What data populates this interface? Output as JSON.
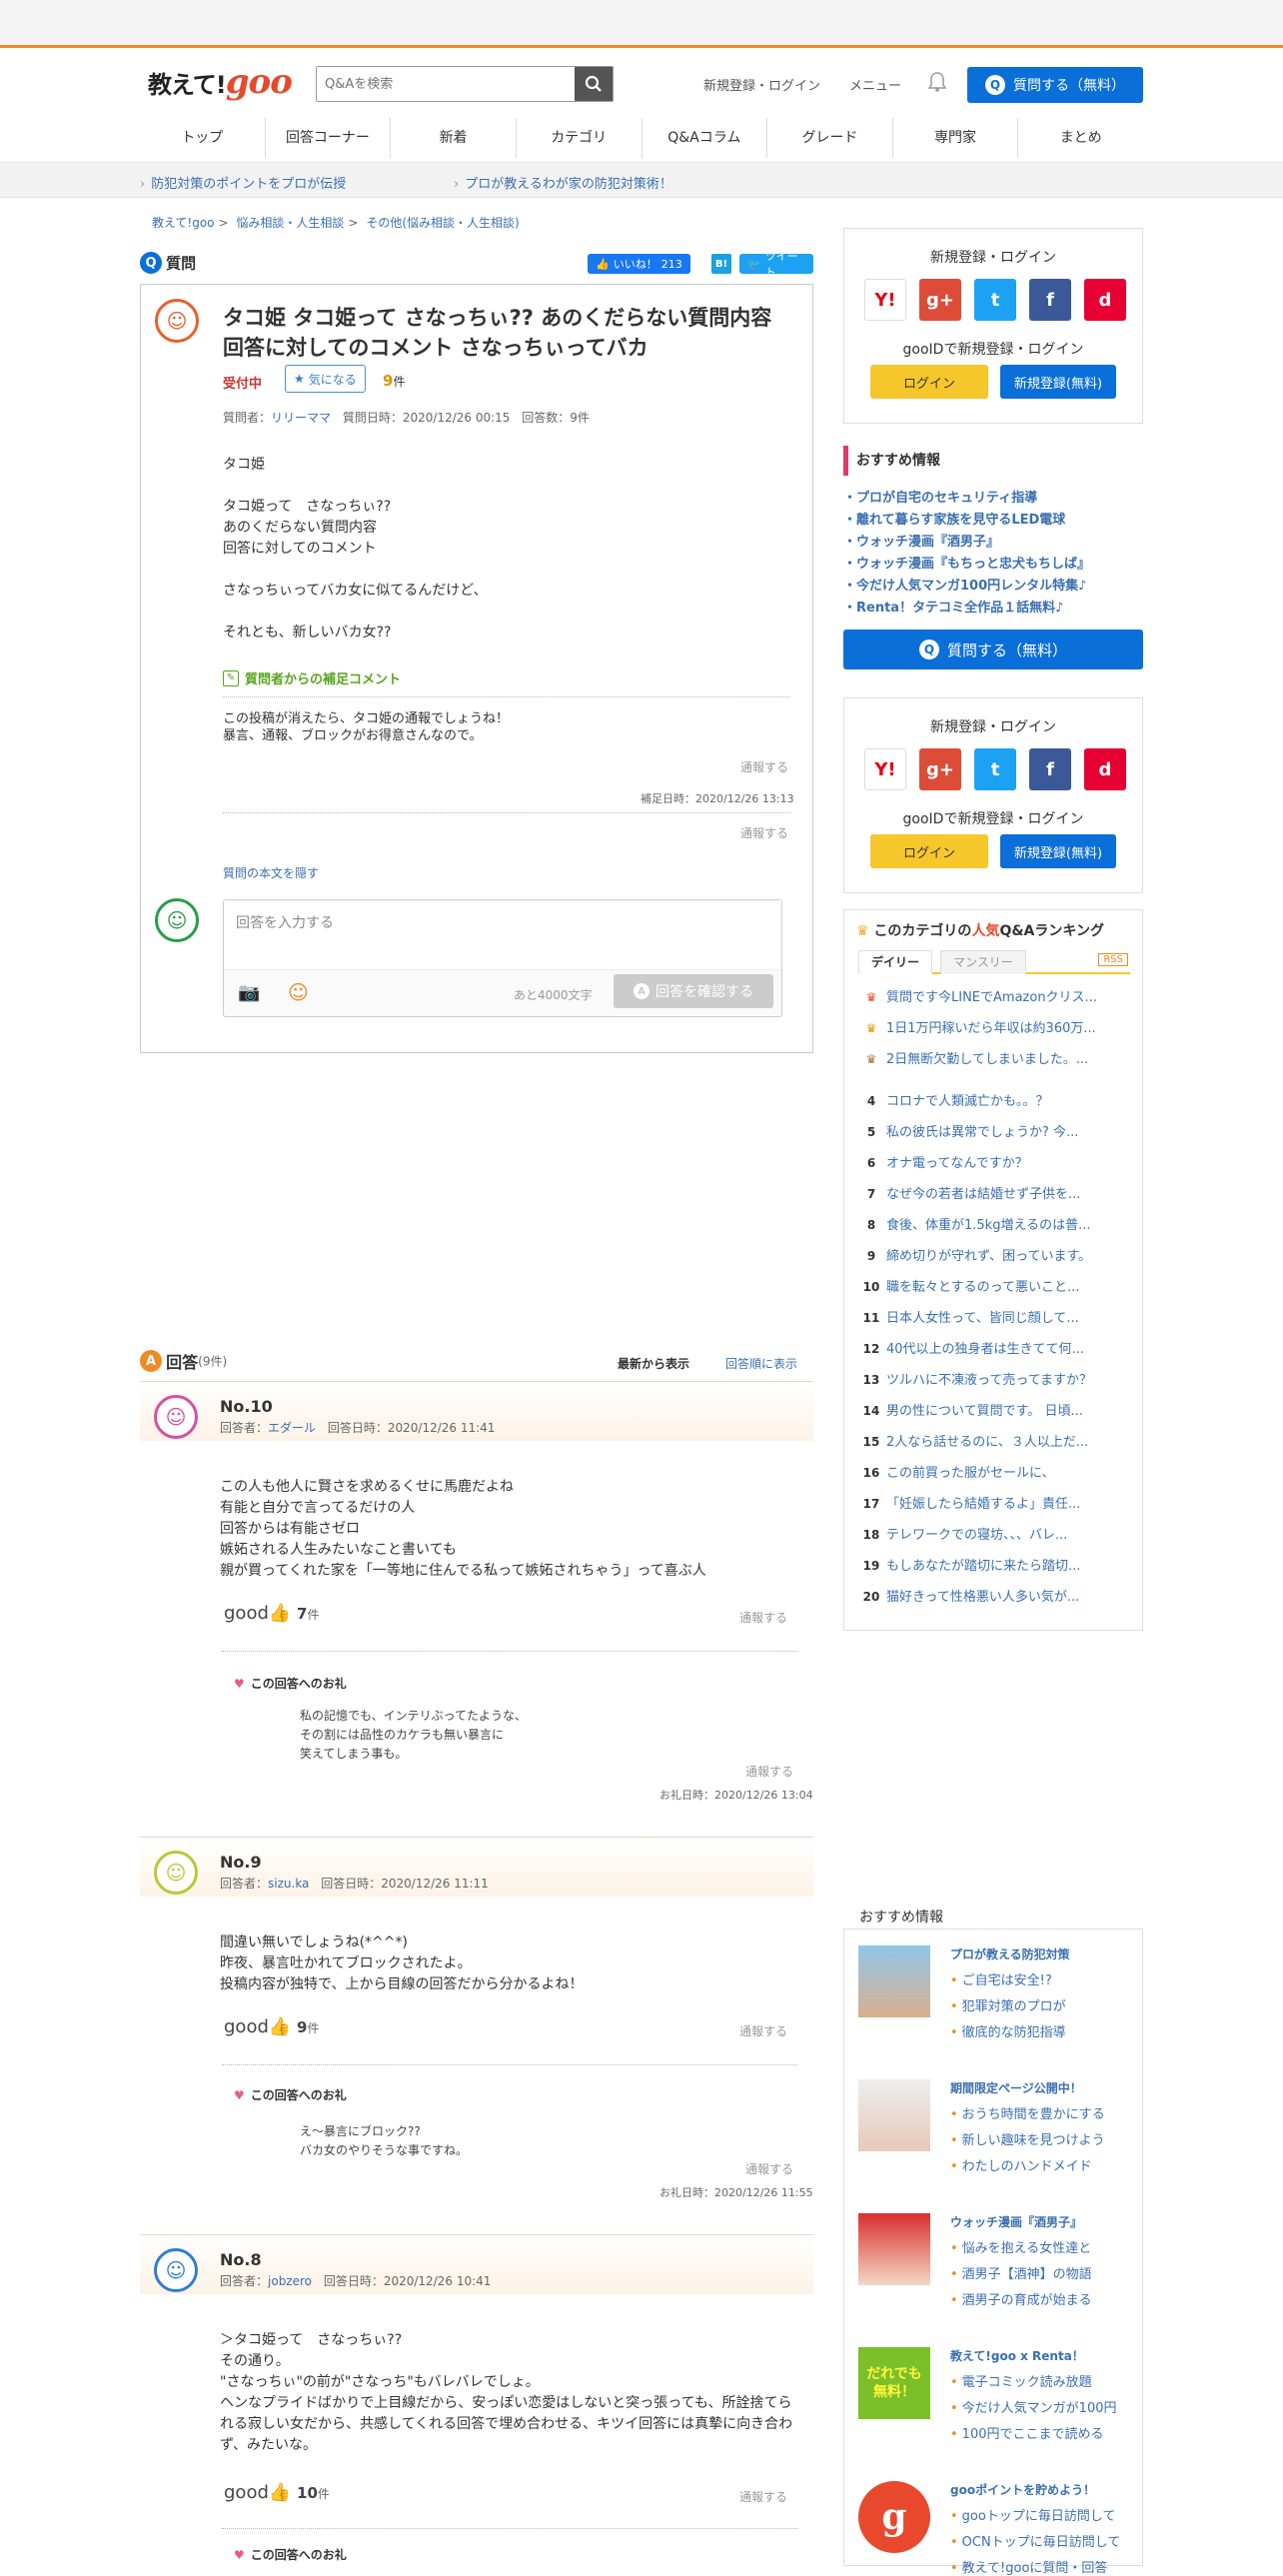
{
  "header": {
    "logo_text": "教えて!",
    "logo_brand": "goo",
    "search_placeholder": "Q&Aを検索",
    "register_login": "新規登録・ログイン",
    "menu": "メニュー",
    "ask_button": "質問する（無料）"
  },
  "nav": [
    "トップ",
    "回答コーナー",
    "新着",
    "カテゴリ",
    "Q&Aコラム",
    "グレード",
    "専門家",
    "まとめ"
  ],
  "subbar": [
    "防犯対策のポイントをプロが伝授",
    "プロが教えるわが家の防犯対策術！"
  ],
  "breadcrumb": [
    "教えて!goo",
    "悩み相談・人生相談",
    "その他(悩み相談・人生相談)"
  ],
  "question": {
    "section_label": "質問",
    "like_label": "いいね！",
    "like_count": "213",
    "hatena": "B!",
    "tweet": "ツイート",
    "title": "タコ姫 タコ姫って さなっちぃ?? あのくだらない質問内容 回答に対してのコメント さなっちぃってバカ",
    "status": "受付中",
    "favorite": "気になる",
    "answer_count": "9",
    "answer_count_unit": "件",
    "asker_label": "質問者：",
    "asker": "リリーママ",
    "date_label": "質問日時：2020/12/26 00:15",
    "answers_label": "回答数：9件",
    "body": "タコ姫\n\nタコ姫って　さなっちぃ??\nあのくだらない質問内容\n回答に対してのコメント\n\nさなっちぃってバカ女に似てるんだけど、\n\nそれとも、新しいバカ女??",
    "supplement_head": "質問者からの補足コメント",
    "supplement_body": "この投稿が消えたら、タコ姫の通報でしょうね！\n暴言、通報、ブロックがお得意さんなので。",
    "report": "通報する",
    "supplement_date": "補足日時：2020/12/26 13:13",
    "hide_body": "質問の本文を隠す",
    "answer_placeholder": "回答を入力する",
    "remaining": "あと4000文字",
    "confirm": "回答を確認する"
  },
  "answers_header": {
    "label": "回答",
    "count": "(9件)",
    "sort_new": "最新から表示",
    "sort_order": "回答順に表示"
  },
  "answers": [
    {
      "no": "No.10",
      "answerer_label": "回答者：",
      "answerer": "エダール",
      "date": "回答日時：2020/12/26 11:41",
      "body": "この人も他人に賢さを求めるくせに馬鹿だよね\n有能と自分で言ってるだけの人\n回答からは有能さゼロ\n嫉妬される人生みたいなこと書いても\n親が買ってくれた家を「一等地に住んでる私って嫉妬されちゃう」って喜ぶ人",
      "good_label": "good",
      "good_count": "7",
      "good_unit": "件",
      "report": "通報する",
      "thanks_head": "この回答へのお礼",
      "thanks_body": "私の記憶でも、インテリぶってたような、\nその割には品性のカケラも無い暴言に\n笑えてしまう事も。",
      "thanks_date": "お礼日時：2020/12/26 13:04"
    },
    {
      "no": "No.9",
      "answerer_label": "回答者：",
      "answerer": "sizu.ka",
      "date": "回答日時：2020/12/26 11:11",
      "body": "間違い無いでしょうね(*^^*)\n昨夜、暴言吐かれてブロックされたよ。\n投稿内容が独特で、上から目線の回答だから分かるよね！",
      "good_label": "good",
      "good_count": "9",
      "good_unit": "件",
      "report": "通報する",
      "thanks_head": "この回答へのお礼",
      "thanks_body": "え～暴言にブロック??\nバカ女のやりそうな事ですね。",
      "thanks_date": "お礼日時：2020/12/26 11:55"
    },
    {
      "no": "No.8",
      "answerer_label": "回答者：",
      "answerer": "jobzero",
      "date": "回答日時：2020/12/26 10:41",
      "body": "＞タコ姫って　さなっちぃ??\nその通り。\n\"さなっちぃ\"の前が\"さなっち\"もバレバレでしょ。\nヘンなプライドばかりで上目線だから、安っぽい恋愛はしないと突っ張っても、所詮捨てられる寂しい女だから、共感してくれる回答で埋め合わせる、キツイ回答には真摯に向き合わず、みたいな。",
      "good_label": "good",
      "good_count": "10",
      "good_unit": "件",
      "report": "通報する",
      "thanks_head": "この回答へのお礼"
    }
  ],
  "sidebar": {
    "login_title": "新規登録・ログイン",
    "gooid_text": "gooIDで新規登録・ログイン",
    "login": "ログイン",
    "register": "新規登録(無料)",
    "sns": [
      "Y!",
      "g+",
      "t",
      "f",
      "d"
    ],
    "recommend_title": "おすすめ情報",
    "recommend": [
      "・プロが自宅のセキュリティ指導",
      "・離れて暮らす家族を見守るLED電球",
      "・ウォッチ漫画『酒男子』",
      "・ウォッチ漫画『もちっと忠犬もちしば』",
      "・今だけ人気マンガ100円レンタル特集♪",
      "・Renta！タテコミ全作品１話無料♪"
    ],
    "ask_button": "質問する（無料）",
    "ranking_title_pre": "このカテゴリの",
    "ranking_title_em": "人気",
    "ranking_title_post": "Q&Aランキング",
    "tab_daily": "デイリー",
    "tab_monthly": "マンスリー",
    "rss": "RSS",
    "ranking": [
      "質問です今LINEでAmazonクリス...",
      "1日1万円稼いだら年収は約360万...",
      "2日無断欠勤してしまいました。...",
      "コロナで人類滅亡かも。。？",
      "私の彼氏は異常でしょうか? 今...",
      "オナ電ってなんですか？",
      "なぜ今の若者は結婚せず子供を...",
      "食後、体重が1.5kg増えるのは普...",
      "締め切りが守れず、困っています。",
      "職を転々とするのって悪いこと...",
      "日本人女性って、皆同じ顔して...",
      "40代以上の独身者は生きてて何...",
      "ツルハに不凍液って売ってますか？",
      "男の性について質問です。 日頃...",
      "2人なら話せるのに、３人以上だ...",
      "この前買った服がセールに、",
      "「妊娠したら結婚するよ」責任...",
      "テレワークでの寝坊、、、バレ...",
      "もしあなたが踏切に来たら踏切...",
      "猫好きって性格悪い人多い気が..."
    ],
    "rec2_title": "おすすめ情報",
    "rec2": [
      {
        "title": "プロが教える防犯対策",
        "items": [
          "ご自宅は安全!?",
          "犯罪対策のプロが",
          "徹底的な防犯指導"
        ]
      },
      {
        "title": "期間限定ページ公開中！",
        "items": [
          "おうち時間を豊かにする",
          "新しい趣味を見つけよう",
          "わたしのハンドメイド"
        ]
      },
      {
        "title": "ウォッチ漫画『酒男子』",
        "items": [
          "悩みを抱える女性達と",
          "酒男子【酒神】の物語",
          "酒男子の育成が始まる"
        ]
      },
      {
        "title": "教えて!goo x Renta！",
        "items": [
          "電子コミック読み放題",
          "今だけ人気マンガが100円",
          "100円でここまで読める"
        ],
        "badge": "だれでも\n無料！"
      },
      {
        "title": "gooポイントを貯めよう！",
        "items": [
          "gooトップに毎日訪問して",
          "OCNトップに毎日訪問して",
          "教えて!gooに質問・回答"
        ]
      }
    ]
  },
  "colors": {
    "accent_orange": "#f08a24",
    "brand_red": "#e8482b",
    "primary_blue": "#0a6fd8",
    "link_blue": "#3a6fb0",
    "login_yellow": "#f6c72b"
  }
}
